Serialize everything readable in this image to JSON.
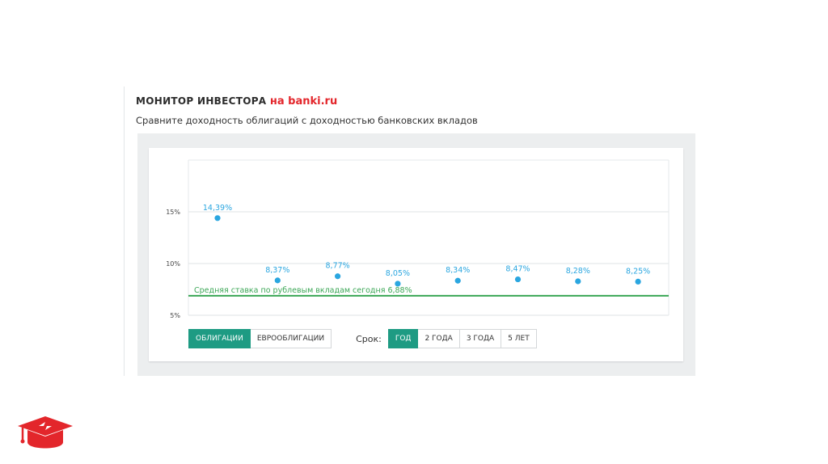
{
  "header": {
    "title": "МОНИТОР ИНВЕСТОРА",
    "brand": "на banki.ru",
    "subtitle": "Сравните доходность облигаций с доходностью банковских вкладов"
  },
  "colors": {
    "accent": "#1e9b83",
    "points": "#2aa6e0",
    "avg_line": "#3aa655",
    "brand": "#e3262b"
  },
  "chart_data": {
    "type": "scatter",
    "values": [
      14.39,
      8.37,
      8.77,
      8.05,
      8.34,
      8.47,
      8.28,
      8.25
    ],
    "data_labels": [
      "14,39%",
      "8,37%",
      "8,77%",
      "8,05%",
      "8,34%",
      "8,47%",
      "8,28%",
      "8,25%"
    ],
    "y_ticks": [
      {
        "value": 5,
        "label": "5%"
      },
      {
        "value": 10,
        "label": "10%"
      },
      {
        "value": 15,
        "label": "15%"
      }
    ],
    "ylim": [
      5,
      20
    ],
    "grid": true,
    "reference_line": {
      "value": 6.88,
      "label": "Средняя ставка по рублевым вкладам сегодня 6,88%"
    }
  },
  "controls": {
    "type_tabs": [
      {
        "label": "ОБЛИГАЦИИ",
        "active": true
      },
      {
        "label": "ЕВРООБЛИГАЦИИ",
        "active": false
      }
    ],
    "term_label": "Срок:",
    "term_tabs": [
      {
        "label": "ГОД",
        "active": true
      },
      {
        "label": "2 ГОДА",
        "active": false
      },
      {
        "label": "3 ГОДА",
        "active": false
      },
      {
        "label": "5 ЛЕТ",
        "active": false
      }
    ]
  }
}
